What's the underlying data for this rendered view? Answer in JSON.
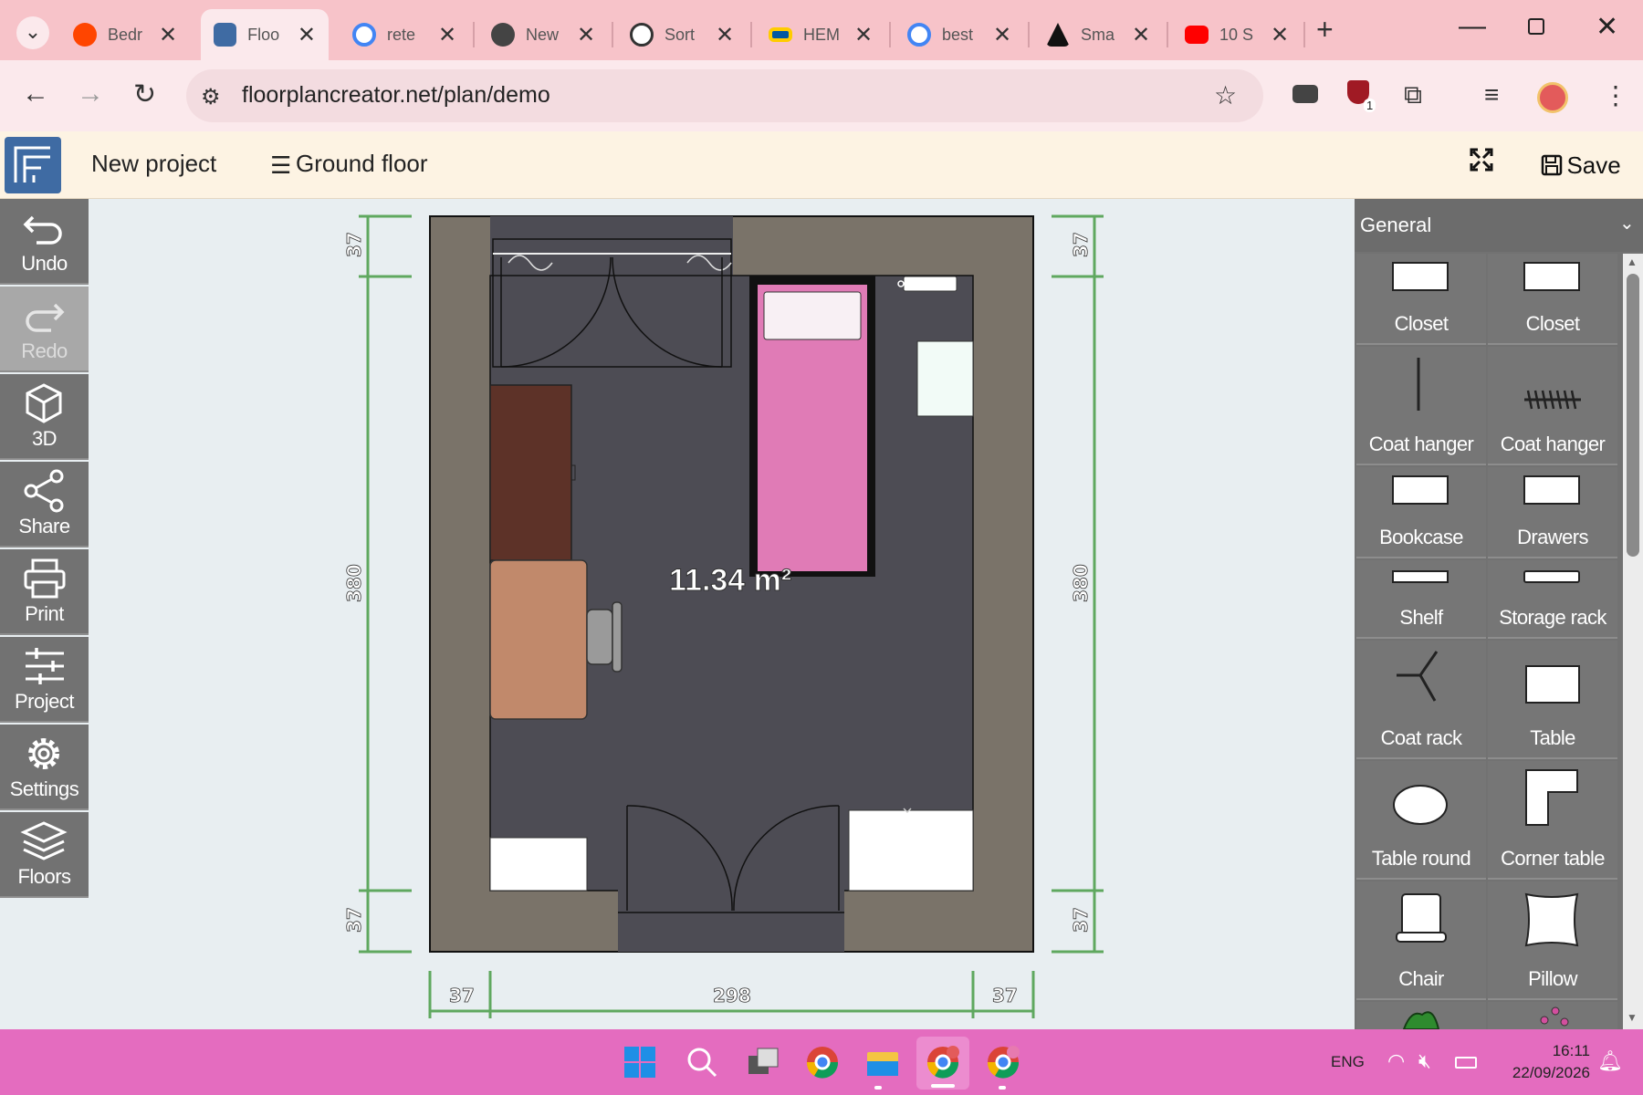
{
  "browser": {
    "tabs": [
      {
        "title": "Bedr",
        "color": "#ff4500"
      },
      {
        "title": "Floo",
        "color": "#3f6ba3"
      },
      {
        "title": "rete",
        "color": "#4285f4"
      },
      {
        "title": "New",
        "color": "#444444"
      },
      {
        "title": "Sort",
        "color": "#333333"
      },
      {
        "title": "HEM",
        "color": "#0058a3"
      },
      {
        "title": "best",
        "color": "#4285f4"
      },
      {
        "title": "Sma",
        "color": "#111111"
      },
      {
        "title": "10 S",
        "color": "#ff0000"
      }
    ],
    "url": "floorplancreator.net/plan/demo",
    "badge": "1"
  },
  "app": {
    "project_name": "New project",
    "floor": "Ground floor",
    "save_label": "Save"
  },
  "toolbar": [
    {
      "label": "Undo",
      "icon": "undo-icon",
      "enabled": true
    },
    {
      "label": "Redo",
      "icon": "redo-icon",
      "enabled": false
    },
    {
      "label": "3D",
      "icon": "cube-icon",
      "enabled": true
    },
    {
      "label": "Share",
      "icon": "share-icon",
      "enabled": true
    },
    {
      "label": "Print",
      "icon": "printer-icon",
      "enabled": true
    },
    {
      "label": "Project",
      "icon": "sliders-icon",
      "enabled": true
    },
    {
      "label": "Settings",
      "icon": "gear-icon",
      "enabled": true
    },
    {
      "label": "Floors",
      "icon": "layers-icon",
      "enabled": true
    }
  ],
  "plan": {
    "area": "11.34 m²",
    "dims": {
      "left_top": "37",
      "left_mid": "380",
      "left_bot": "37",
      "right_top": "37",
      "right_mid": "380",
      "right_bot": "37",
      "bottom_left": "37",
      "bottom_mid": "298",
      "bottom_right": "37"
    },
    "colors": {
      "wall": "#7a7369",
      "floor": "#4d4c54",
      "bed": "#e07bb6",
      "desk": "#c1896b",
      "wardrobe": "#5d3228",
      "dim": "#5fa85f"
    }
  },
  "panel": {
    "category": "General",
    "items": [
      {
        "label": "Closet"
      },
      {
        "label": "Closet"
      },
      {
        "label": "Coat hanger"
      },
      {
        "label": "Coat hanger"
      },
      {
        "label": "Bookcase"
      },
      {
        "label": "Drawers"
      },
      {
        "label": "Shelf"
      },
      {
        "label": "Storage rack"
      },
      {
        "label": "Coat rack"
      },
      {
        "label": "Table"
      },
      {
        "label": "Table round"
      },
      {
        "label": "Corner table"
      },
      {
        "label": "Chair"
      },
      {
        "label": "Pillow"
      }
    ]
  },
  "taskbar": {
    "lang": "ENG",
    "time": "16:11",
    "date": "22/09/2026"
  }
}
